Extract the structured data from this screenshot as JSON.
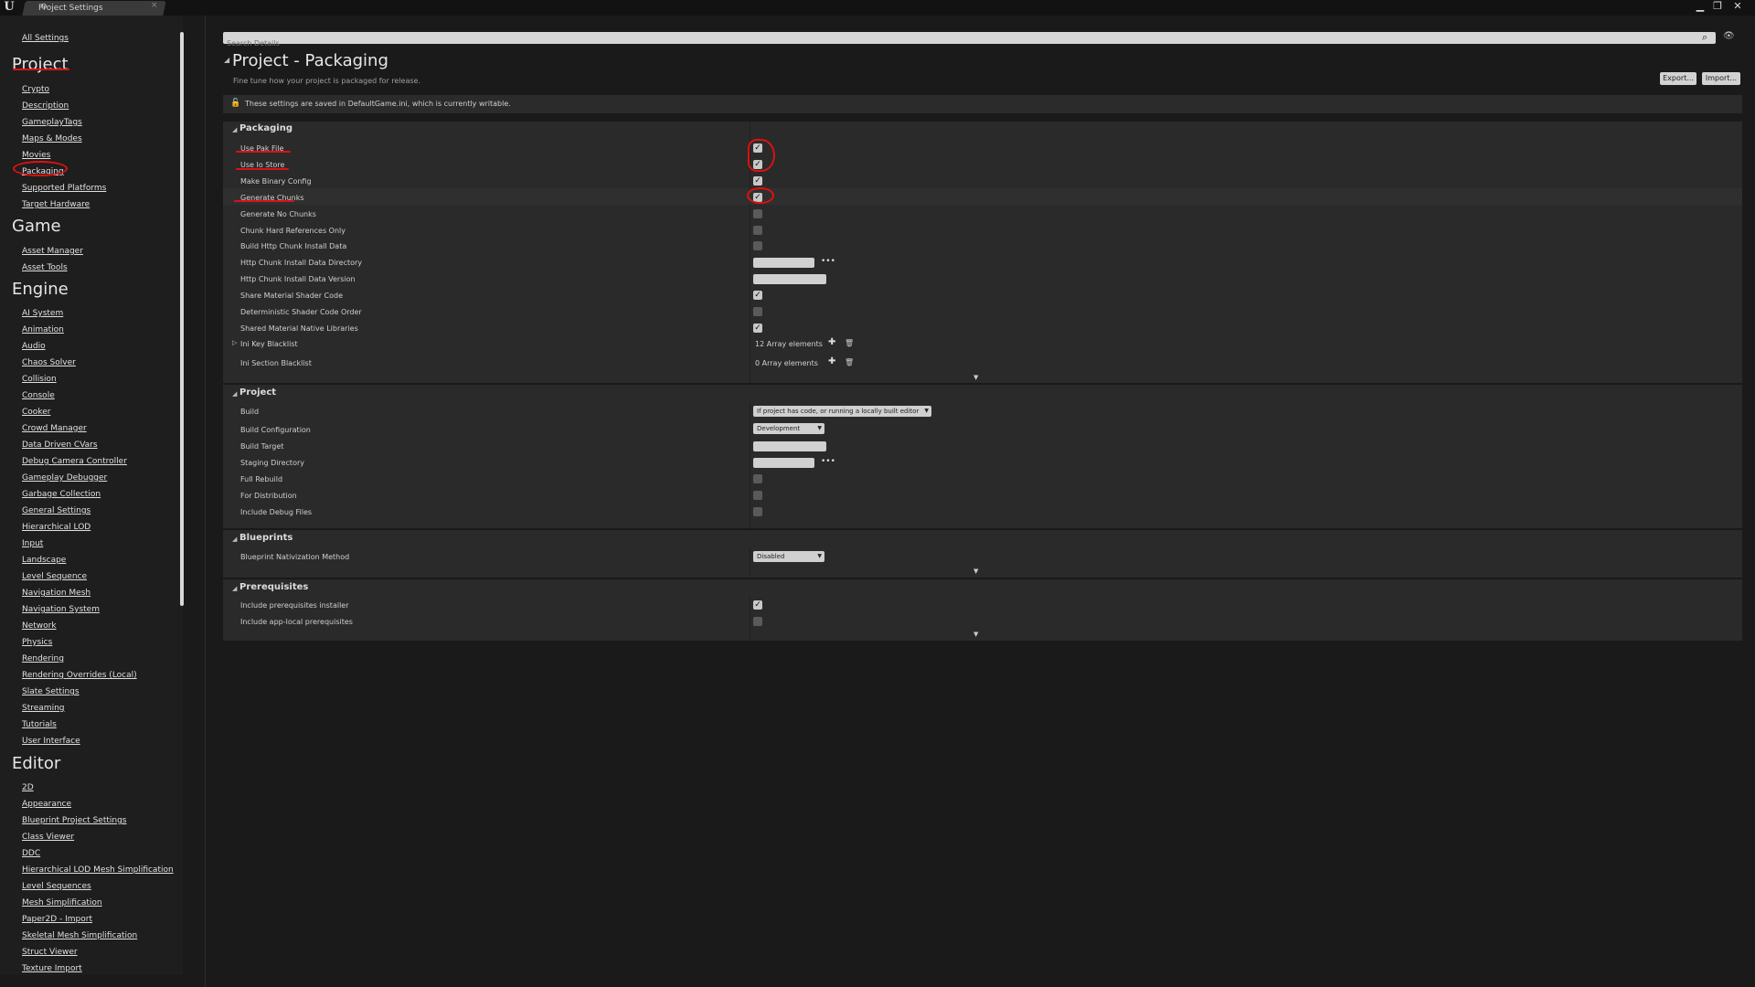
{
  "window": {
    "tab_title": "Project Settings",
    "tab_close": "×",
    "minimize": "▁",
    "maximize": "❐",
    "close": "✕"
  },
  "sidebar": {
    "all_settings": "All Settings",
    "categories": [
      {
        "title": "Project",
        "items": [
          "Crypto",
          "Description",
          "GameplayTags",
          "Maps & Modes",
          "Movies",
          "Packaging",
          "Supported Platforms",
          "Target Hardware"
        ]
      },
      {
        "title": "Game",
        "items": [
          "Asset Manager",
          "Asset Tools"
        ]
      },
      {
        "title": "Engine",
        "items": [
          "AI System",
          "Animation",
          "Audio",
          "Chaos Solver",
          "Collision",
          "Console",
          "Cooker",
          "Crowd Manager",
          "Data Driven CVars",
          "Debug Camera Controller",
          "Gameplay Debugger",
          "Garbage Collection",
          "General Settings",
          "Hierarchical LOD",
          "Input",
          "Landscape",
          "Level Sequence",
          "Navigation Mesh",
          "Navigation System",
          "Network",
          "Physics",
          "Rendering",
          "Rendering Overrides (Local)",
          "Slate Settings",
          "Streaming",
          "Tutorials",
          "User Interface"
        ]
      },
      {
        "title": "Editor",
        "items": [
          "2D",
          "Appearance",
          "Blueprint Project Settings",
          "Class Viewer",
          "DDC",
          "Hierarchical LOD Mesh Simplification",
          "Level Sequences",
          "Mesh Simplification",
          "Paper2D - Import",
          "Skeletal Mesh Simplification",
          "Struct Viewer",
          "Texture Import"
        ]
      }
    ]
  },
  "search": {
    "placeholder": "Search Details"
  },
  "header": {
    "title": "Project - Packaging",
    "subtitle": "Fine tune how your project is packaged for release.",
    "export_label": "Export...",
    "import_label": "Import..."
  },
  "notice": "These settings are saved in DefaultGame.ini, which is currently writable.",
  "sections": {
    "packaging": {
      "title": "Packaging",
      "rows": [
        {
          "label": "Use Pak File",
          "type": "checkbox",
          "checked": true
        },
        {
          "label": "Use Io Store",
          "type": "checkbox",
          "checked": true
        },
        {
          "label": "Make Binary Config",
          "type": "checkbox",
          "checked": true
        },
        {
          "label": "Generate Chunks",
          "type": "checkbox",
          "checked": true
        },
        {
          "label": "Generate No Chunks",
          "type": "checkbox",
          "checked": false
        },
        {
          "label": "Chunk Hard References Only",
          "type": "checkbox",
          "checked": false
        },
        {
          "label": "Build Http Chunk Install Data",
          "type": "checkbox",
          "checked": false
        },
        {
          "label": "Http Chunk Install Data Directory",
          "type": "path"
        },
        {
          "label": "Http Chunk Install Data Version",
          "type": "text"
        },
        {
          "label": "Share Material Shader Code",
          "type": "checkbox",
          "checked": true
        },
        {
          "label": "Deterministic Shader Code Order",
          "type": "checkbox",
          "checked": false
        },
        {
          "label": "Shared Material Native Libraries",
          "type": "checkbox",
          "checked": true
        }
      ],
      "ini_key_blacklist": {
        "label": "Ini Key Blacklist",
        "value": "12 Array elements"
      },
      "ini_section_blacklist": {
        "label": "Ini Section Blacklist",
        "value": "0 Array elements"
      }
    },
    "project": {
      "title": "Project",
      "build": {
        "label": "Build",
        "value": "If project has code, or running a locally built editor"
      },
      "build_configuration": {
        "label": "Build Configuration",
        "value": "Development"
      },
      "build_target": {
        "label": "Build Target"
      },
      "staging_directory": {
        "label": "Staging Directory"
      },
      "full_rebuild": {
        "label": "Full Rebuild",
        "checked": false
      },
      "for_distribution": {
        "label": "For Distribution",
        "checked": false
      },
      "include_debug_files": {
        "label": "Include Debug Files",
        "checked": false
      }
    },
    "blueprints": {
      "title": "Blueprints",
      "nativization": {
        "label": "Blueprint Nativization Method",
        "value": "Disabled"
      }
    },
    "prerequisites": {
      "title": "Prerequisites",
      "installer": {
        "label": "Include prerequisites installer",
        "checked": true
      },
      "app_local": {
        "label": "Include app-local prerequisites",
        "checked": false
      }
    }
  },
  "glyphs": {
    "check": "✓",
    "dots": "•••",
    "plus": "✚",
    "trash": "🗑",
    "chevron": "▼",
    "triangle_open": "◢",
    "triangle_closed": "▷",
    "search": "⌕",
    "eye": "👁"
  },
  "colors": {
    "background": "#1a1a1a",
    "panel": "#2a2a2a",
    "annotation": "#d11111"
  }
}
